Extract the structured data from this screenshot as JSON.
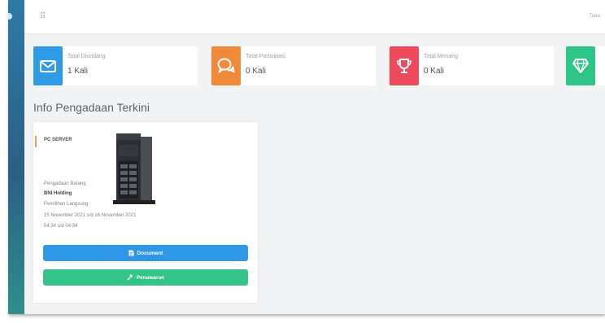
{
  "topbar": {
    "menu_glyph": "⠿",
    "user_label": "Tiara"
  },
  "stats": [
    {
      "title": "Total Diundang",
      "value": "1 Kali",
      "color": "#2d9be6",
      "icon": "envelope-icon"
    },
    {
      "title": "Total Partisipasi",
      "value": "0 Kali",
      "color": "#f08a3a",
      "icon": "chat-bubbles-icon"
    },
    {
      "title": "Total Menang",
      "value": "0 Kali",
      "color": "#ee4a5c",
      "icon": "trophy-icon"
    },
    {
      "title": "",
      "value": "",
      "color": "#2ec487",
      "icon": "diamond-icon"
    }
  ],
  "section": {
    "title": "Info Pengadaan Terkini"
  },
  "tender": {
    "title": "PC SERVER",
    "type": "Pengadaan Barang",
    "company": "BNI Holding",
    "method": "Pemilihan Langsung",
    "date_range": "15 November 2021  s/d  16 November 2021",
    "time_range": "04:34  s/d  04:34",
    "document_button": "Document",
    "bid_button": "Penawaran",
    "image_icon": "server-tower-icon"
  }
}
